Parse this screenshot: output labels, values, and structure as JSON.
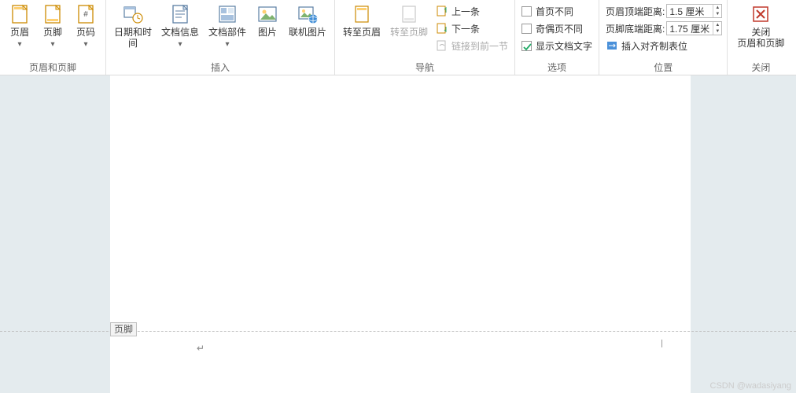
{
  "ribbon": {
    "group_headerfooter": {
      "label": "页眉和页脚",
      "header_btn": "页眉",
      "footer_btn": "页脚",
      "pagenum_btn": "页码"
    },
    "group_insert": {
      "label": "插入",
      "date_time_btn": "日期和时间",
      "doc_info_btn": "文档信息",
      "doc_part_btn": "文档部件",
      "picture_btn": "图片",
      "online_pic_btn": "联机图片"
    },
    "group_nav": {
      "label": "导航",
      "goto_header_btn": "转至页眉",
      "goto_footer_btn": "转至页脚",
      "prev_btn": "上一条",
      "next_btn": "下一条",
      "link_prev_btn": "链接到前一节"
    },
    "group_options": {
      "label": "选项",
      "diff_first": "首页不同",
      "diff_oddeven": "奇偶页不同",
      "show_doctext": "显示文档文字",
      "show_doctext_checked": true
    },
    "group_position": {
      "label": "位置",
      "top_dist_label": "页眉顶端距离:",
      "top_dist_value": "1.5 厘米",
      "bot_dist_label": "页脚底端距离:",
      "bot_dist_value": "1.75 厘米",
      "insert_tab": "插入对齐制表位"
    },
    "group_close": {
      "label": "关闭",
      "close_btn_line1": "关闭",
      "close_btn_line2": "页眉和页脚"
    }
  },
  "doc": {
    "footer_tag": "页脚",
    "cursor_glyph": "↵",
    "watermark": "CSDN @wadasiyang"
  }
}
